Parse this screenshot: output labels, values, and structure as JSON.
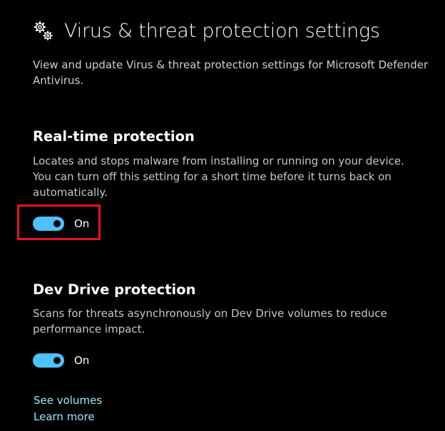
{
  "header": {
    "title": "Virus & threat protection settings",
    "icon": "gear-icon"
  },
  "subtitle": "View and update Virus & threat protection settings for Microsoft Defender Antivirus.",
  "real_time": {
    "title": "Real-time protection",
    "description": "Locates and stops malware from installing or running on your device. You can turn off this setting for a short time before it turns back on automatically.",
    "toggle_state": "On",
    "toggle_on": true
  },
  "dev_drive": {
    "title": "Dev Drive protection",
    "description": "Scans for threats asynchronously on Dev Drive volumes to reduce performance impact.",
    "toggle_state": "On",
    "toggle_on": true
  },
  "links": {
    "see_volumes": "See volumes",
    "learn_more": "Learn more"
  },
  "colors": {
    "background": "#000000",
    "toggle_accent": "#4cc2ff",
    "link": "#99ebff",
    "highlight": "#e81123"
  }
}
